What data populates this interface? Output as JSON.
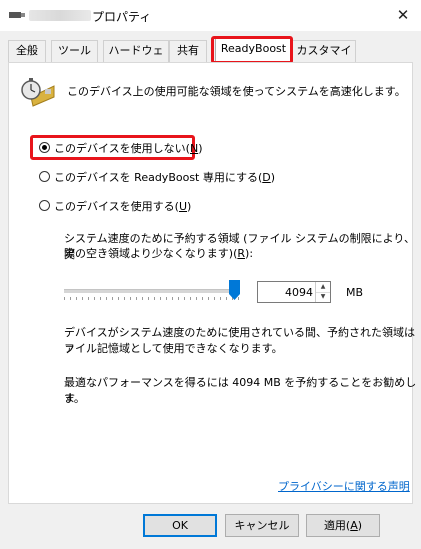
{
  "window": {
    "title_suffix": "プロパティ",
    "close_glyph": "✕"
  },
  "tabs": [
    {
      "label": "全般"
    },
    {
      "label": "ツール"
    },
    {
      "label": "ハードウェア"
    },
    {
      "label": "共有"
    },
    {
      "label": "ReadyBoost",
      "active": true
    },
    {
      "label": "カスタマイズ"
    }
  ],
  "header": {
    "icon": "readyboost-stopwatch-icon",
    "text": "このデバイス上の使用可能な領域を使ってシステムを高速化します。"
  },
  "options": {
    "disable": {
      "label": "このデバイスを使用しない(",
      "key": "N",
      "tail": ")",
      "checked": true
    },
    "dedicate": {
      "label": "このデバイスを ReadyBoost 専用にする(",
      "key": "D",
      "tail": ")",
      "checked": false
    },
    "use": {
      "label": "このデバイスを使用する(",
      "key": "U",
      "tail": ")",
      "checked": false
    }
  },
  "reserve": {
    "line1": "システム速度のために予約する領域 (ファイル システムの制限により、実",
    "line2a": "際の空き領域より少なくなります)(",
    "line2_key": "R",
    "line2b": "):",
    "value": "4094",
    "unit": "MB",
    "slider_fraction": 1.0
  },
  "notes": {
    "p1_line1": "デバイスがシステム速度のために使用されている間、予約された領域はフ",
    "p1_line2": "ァイル記憶域として使用できなくなります。",
    "p2_line1": "最適なパフォーマンスを得るには 4094 MB を予約することをお勧めしま",
    "p2_line2": "す。"
  },
  "privacy_link": "プライバシーに関する声明",
  "buttons": {
    "ok": "OK",
    "cancel": "キャンセル",
    "apply_label": "適用(",
    "apply_key": "A",
    "apply_tail": ")"
  },
  "colors": {
    "accent": "#0078d7",
    "highlight": "#e8141b",
    "link": "#0066cc"
  }
}
